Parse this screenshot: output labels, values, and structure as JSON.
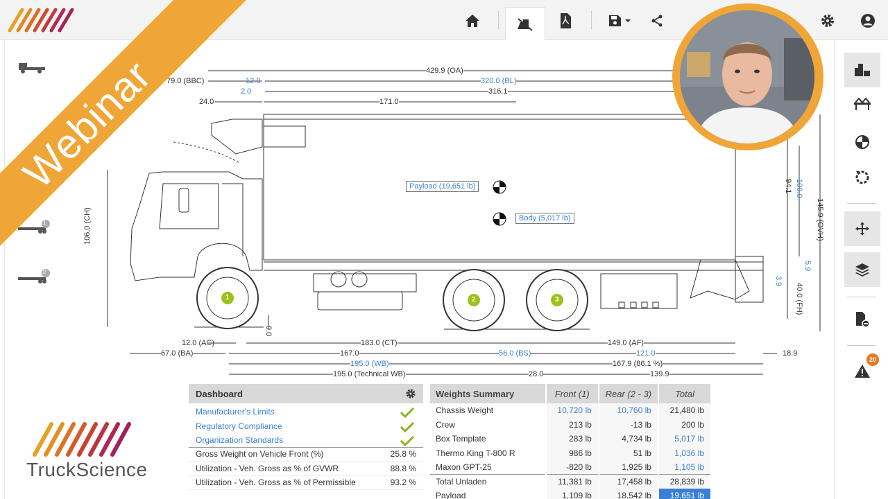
{
  "toolbar": {
    "items": [
      {
        "name": "home-icon"
      },
      {
        "name": "truck-config-icon"
      },
      {
        "name": "pdf-icon"
      },
      {
        "name": "save-icon"
      },
      {
        "name": "share-icon"
      },
      {
        "name": "gear-icon"
      },
      {
        "name": "user-icon"
      }
    ]
  },
  "banner": {
    "text": "Webinar"
  },
  "logo": {
    "text": "TruckScience"
  },
  "dimensions": {
    "oa": "429.9 (OA)",
    "bbc": "79.0 (BBC)",
    "d12": "12.0",
    "bl": "320.0 (BL)",
    "d2": "2.0",
    "d3161": "316.1",
    "d24": "24.0",
    "d171": "171.0",
    "ch": "106.0 (CH)",
    "gc": "9.0",
    "d941": "94.1",
    "d100": "100.0",
    "ovh": "145.9 (OVH)",
    "d59": "5.9",
    "d39": "3.9",
    "fh": "40.0 (FH)",
    "ac": "12.0 (AC)",
    "ct": "183.0 (CT)",
    "af": "149.0 (AF)",
    "ba": "67.0 (BA)",
    "d167": "167.0",
    "bs": "56.0 (BS)",
    "d121": "121.0",
    "d189": "18.9",
    "wb": "195.0 (WB)",
    "d1679": "167.9 (86.1 %)",
    "twb": "195.0 (Technical WB)",
    "d28": "28.0",
    "d1399": "139.9"
  },
  "cg_labels": {
    "payload": "Payload (19,651 lb)",
    "body": "Body (5,017 lb)"
  },
  "axles": [
    "1",
    "2",
    "3"
  ],
  "left_icons": {
    "trailer1_badge": "1",
    "trailer2_badge": "2"
  },
  "dashboard": {
    "title": "Dashboard",
    "links": [
      "Manufacturer's Limits",
      "Regulatory Compliance",
      "Organization Standards"
    ],
    "rows": [
      {
        "label": "Gross Weight on Vehicle Front (%)",
        "value": "25.8 %"
      },
      {
        "label": "Utilization - Veh. Gross as % of GVWR",
        "value": "88.8 %"
      },
      {
        "label": "Utilization - Veh. Gross as % of Permissible",
        "value": "93.2 %"
      }
    ]
  },
  "weights": {
    "title": "Weights Summary",
    "headers": [
      "Front (1)",
      "Rear (2 - 3)",
      "Total"
    ],
    "rows": [
      {
        "label": "Chassis Weight",
        "front": "10,720 lb",
        "rear": "10,760 lb",
        "total": "21,480 lb"
      },
      {
        "label": "Crew",
        "front": "213 lb",
        "rear": "-13 lb",
        "total": "200 lb"
      },
      {
        "label": "Box Template",
        "front": "283 lb",
        "rear": "4,734 lb",
        "total": "5,017 lb"
      },
      {
        "label": "Thermo King T-800 R",
        "front": "986 lb",
        "rear": "51 lb",
        "total": "1,036 lb"
      },
      {
        "label": "Maxon GPT-25",
        "front": "-820 lb",
        "rear": "1,925 lb",
        "total": "1,105 lb"
      },
      {
        "label": "Total Unladen",
        "front": "11,381 lb",
        "rear": "17,458 lb",
        "total": "28,839 lb"
      },
      {
        "label": "Payload",
        "front": "1,109 lb",
        "rear": "18,542 lb",
        "total": "19,651 lb"
      }
    ]
  },
  "alerts": {
    "count": "20"
  },
  "colors": {
    "accent": "#f0a637",
    "link": "#3a7fd5",
    "header_bg": "#d8d8d8"
  }
}
